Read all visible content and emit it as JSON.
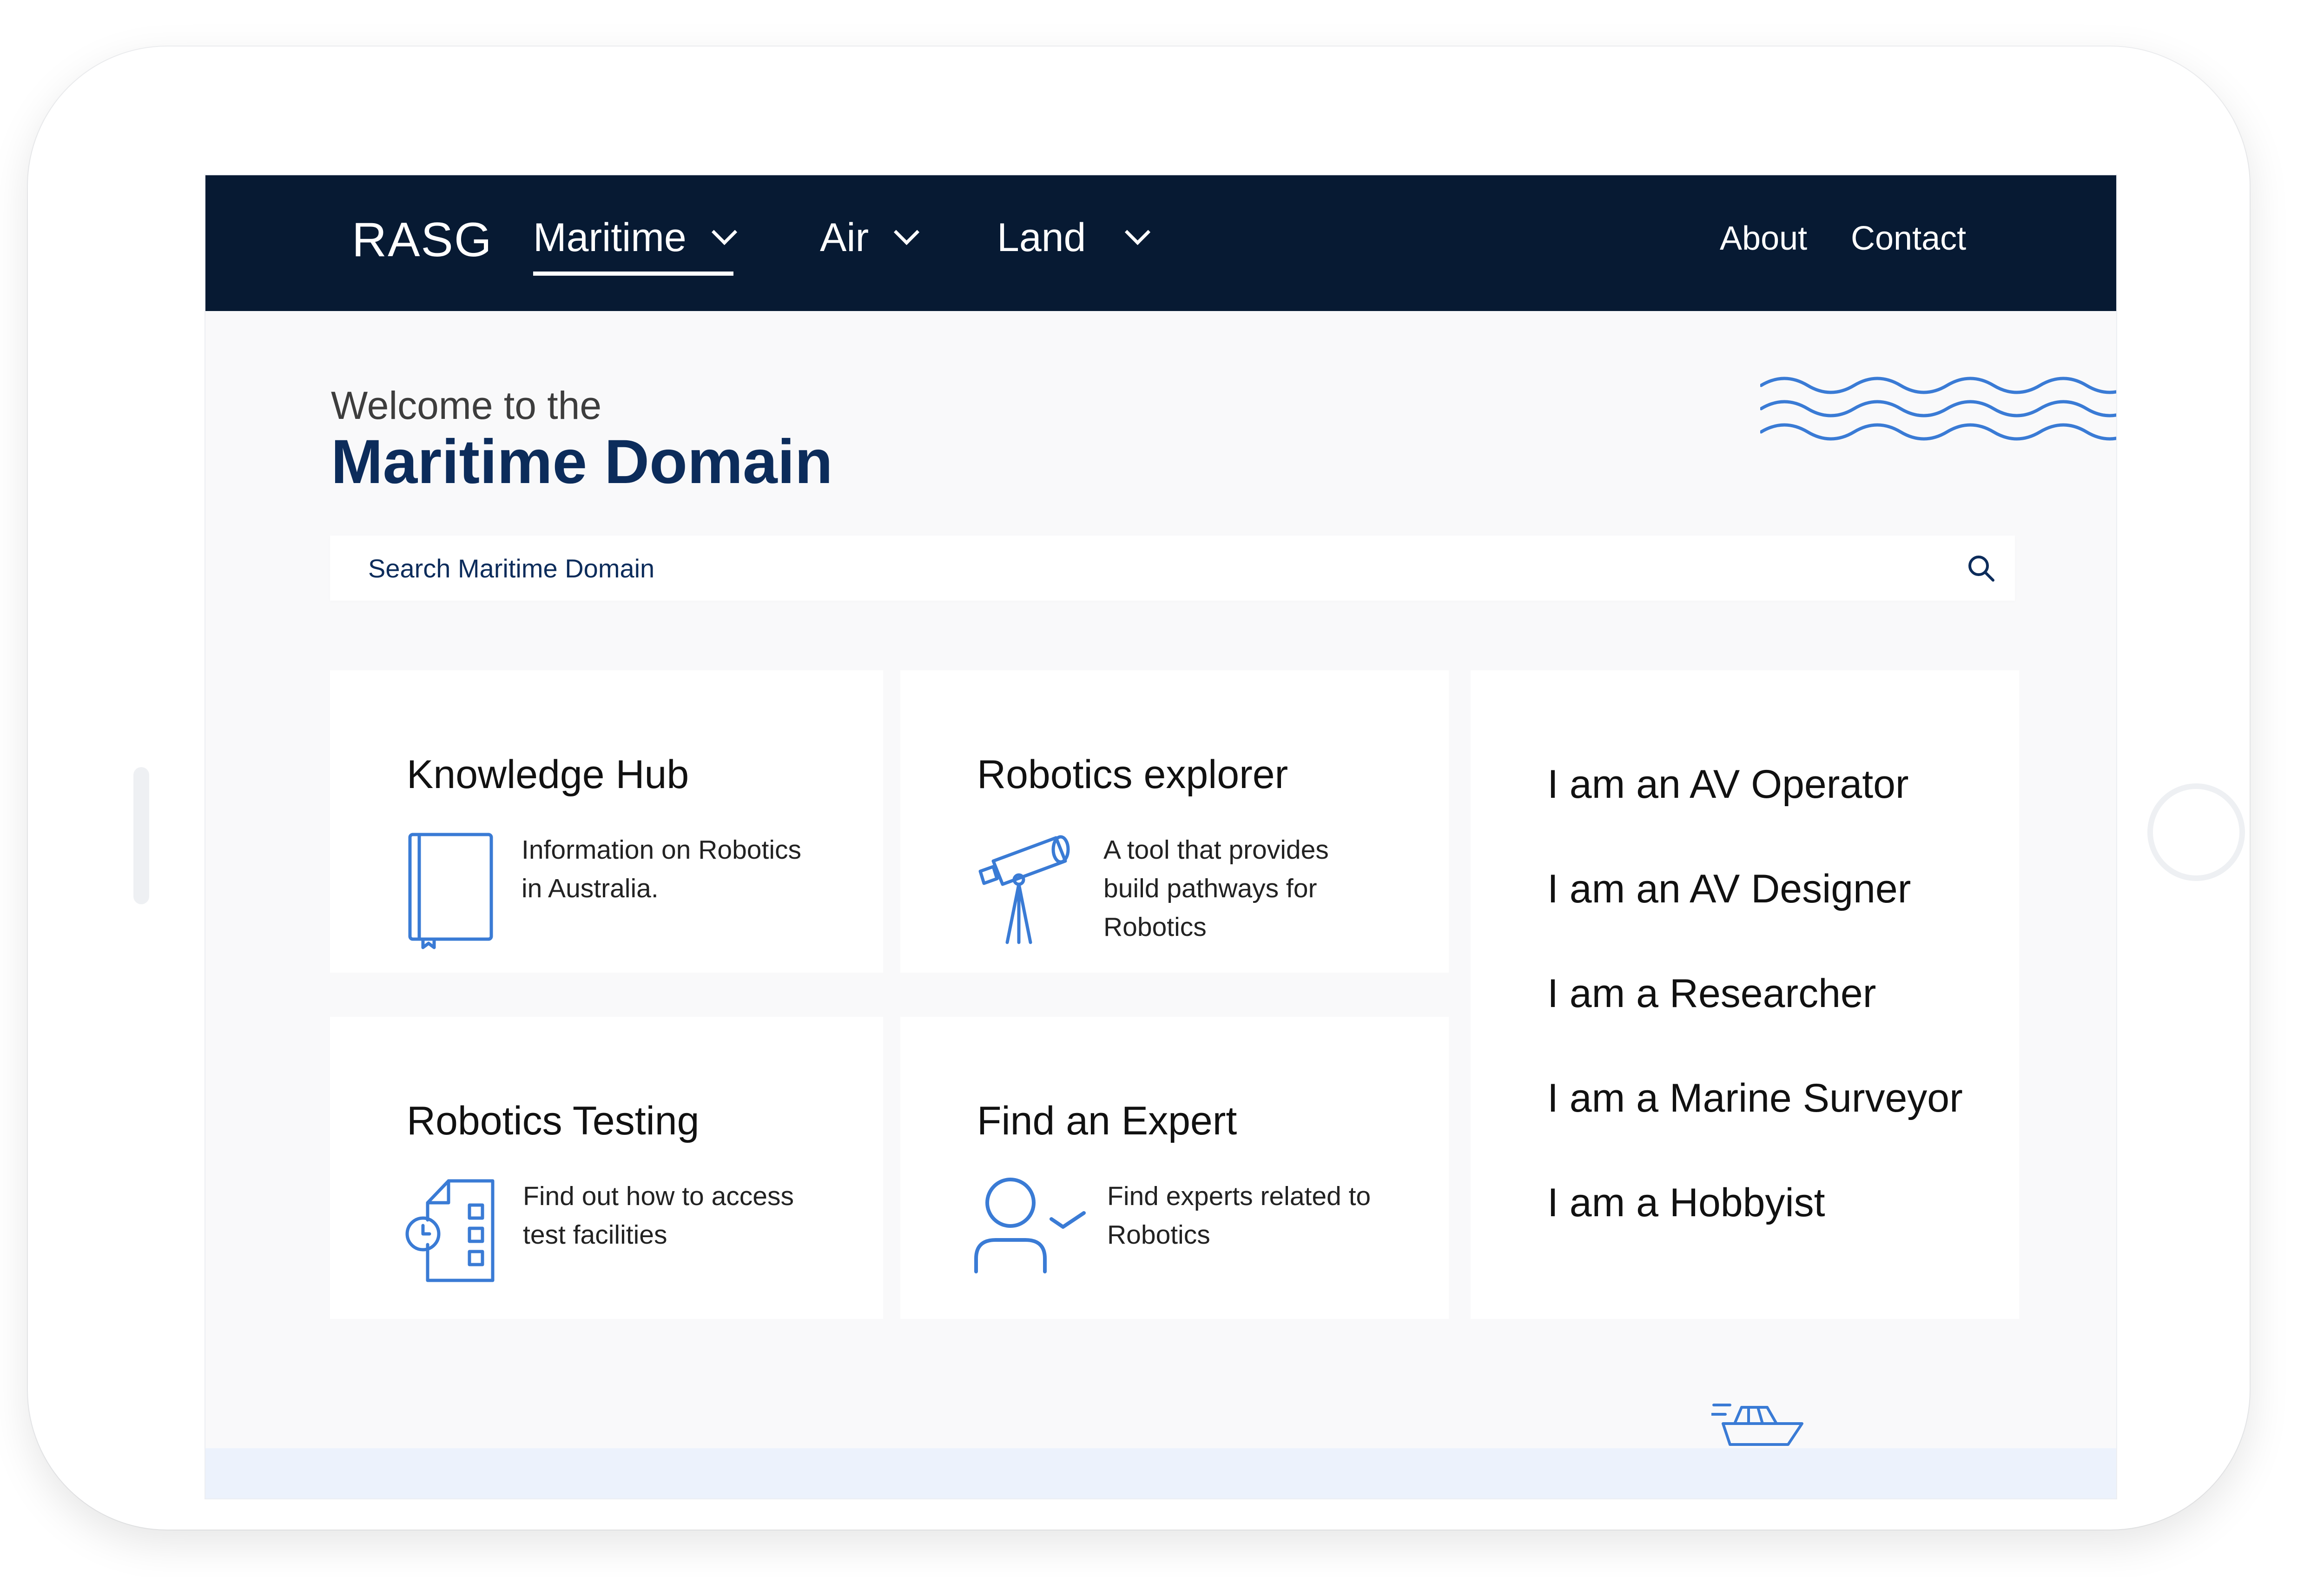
{
  "nav": {
    "brand": "RASG",
    "items": [
      {
        "label": "Maritime",
        "active": true
      },
      {
        "label": "Air",
        "active": false
      },
      {
        "label": "Land",
        "active": false
      }
    ],
    "links": [
      "About",
      "Contact"
    ]
  },
  "hero": {
    "welcome": "Welcome to the",
    "title": "Maritime Domain"
  },
  "search": {
    "placeholder": "Search Maritime Domain",
    "icon": "search-icon"
  },
  "cards": [
    {
      "title": "Knowledge Hub",
      "description": "Information on Robotics in Australia.",
      "icon": "book-icon"
    },
    {
      "title": "Robotics explorer",
      "description": "A tool that provides build pathways for Robotics",
      "icon": "telescope-icon"
    },
    {
      "title": "Robotics Testing",
      "description": "Find out how to access test facilities",
      "icon": "test-document-icon"
    },
    {
      "title": "Find an Expert",
      "description": "Find experts related to Robotics",
      "icon": "user-check-icon"
    }
  ],
  "roles": [
    "I am an AV Operator",
    "I am an AV Designer",
    "I am a Researcher",
    "I am a Marine Surveyor",
    "I am a Hobbyist"
  ],
  "colors": {
    "nav_background": "#071a33",
    "title_blue": "#0c2c5b",
    "icon_blue": "#3a7bd5",
    "footer_band": "#ecf2fc"
  }
}
